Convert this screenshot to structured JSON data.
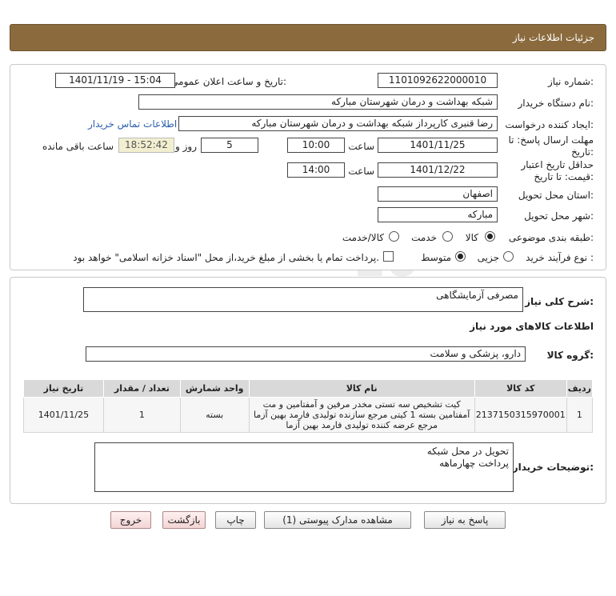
{
  "header": {
    "title": "جزئیات اطلاعات نیاز"
  },
  "form": {
    "need_number_label": "شماره نیاز:",
    "need_number": "1101092622000010",
    "announce_label": "تاریخ و ساعت اعلان عمومی:",
    "announce_value": "1401/11/19 - 15:04",
    "buyer_org_label": "نام دستگاه خریدار:",
    "buyer_org": "شبکه بهداشت و درمان شهرستان مبارکه",
    "requester_label": "ایجاد کننده درخواست:",
    "requester": "رضا قنبری کارپرداز شبکه بهداشت و درمان شهرستان مبارکه",
    "contact_link": "اطلاعات تماس خریدار",
    "deadline_label_1": "مهلت ارسال پاسخ: تا",
    "deadline_label_2": "تاریخ:",
    "deadline_date": "1401/11/25",
    "time_label": "ساعت",
    "deadline_time": "10:00",
    "days_value": "5",
    "days_label": "روز و",
    "remaining_time": "18:52:42",
    "remaining_label": "ساعت باقی مانده",
    "validity_label_1": "حداقل تاریخ اعتبار",
    "validity_label_2": "قیمت: تا تاریخ:",
    "validity_date": "1401/12/22",
    "validity_time_label": "ساعت",
    "validity_time": "14:00",
    "province_label": "استان محل تحویل:",
    "province": "اصفهان",
    "city_label": "شهر محل تحویل:",
    "city": "مبارکه",
    "category_label": "طبقه بندی موضوعی:",
    "category_options": [
      "کالا",
      "خدمت",
      "کالا/خدمت"
    ],
    "process_label": "نوع فرآیند خرید :",
    "process_options": [
      "جزیی",
      "متوسط"
    ],
    "payment_note": "پرداخت تمام یا بخشی از مبلغ خرید،از محل \"اسناد خزانه اسلامی\" خواهد بود."
  },
  "details": {
    "summary_label": "شرح کلی نیاز:",
    "summary": "مصرفی آزمایشگاهی",
    "goods_info_title": "اطلاعات کالاهای مورد نیاز",
    "goods_group_label": "گروه کالا:",
    "goods_group": "دارو، پزشکی و سلامت",
    "table": {
      "headers": [
        "ردیف",
        "کد کالا",
        "نام کالا",
        "واحد شمارش",
        "تعداد / مقدار",
        "تاریخ نیاز"
      ],
      "rows": [
        {
          "index": "1",
          "code": "2137150315970001",
          "name_lines": [
            "کیت تشخیص سه تستی مخدر مرفین و آمفتامین و مت",
            "آمفتامین بسته 1 کیتی مرجع سازنده تولیدی فارمد بهین آزما",
            "مرجع عرضه کننده تولیدی فارمد بهین آزما"
          ],
          "unit": "بسته",
          "qty": "1",
          "date": "1401/11/25"
        }
      ]
    },
    "buyer_notes_label": "توضیحات خریدار:",
    "buyer_notes_lines": [
      "تحویل در محل شبکه",
      "پرداخت چهارماهه"
    ]
  },
  "buttons": {
    "reply": "پاسخ به نیاز",
    "attachments": "مشاهده مدارک پیوستی (1)",
    "print": "چاپ",
    "back": "بازگشت",
    "exit": "خروج"
  },
  "colors": {
    "header": "#8b6b3e",
    "link": "#2a5fb0",
    "remaining_bg": "#f2efd0"
  }
}
